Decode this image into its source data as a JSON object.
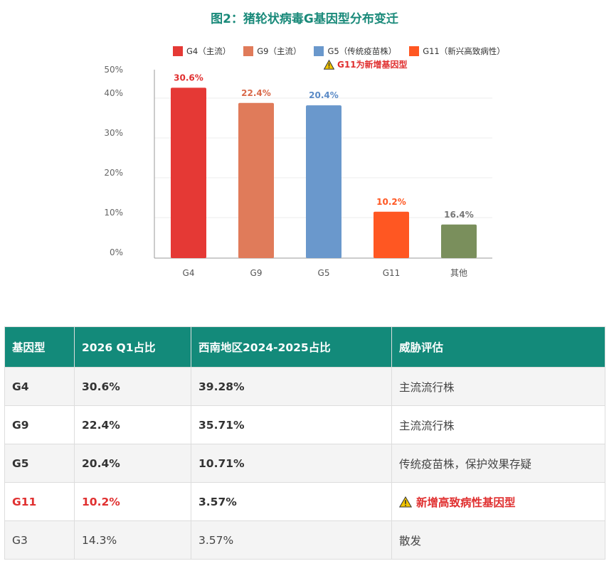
{
  "chart_data": {
    "type": "bar",
    "title": "图2：猪轮状病毒G基因型分布变迁",
    "categories": [
      "G4",
      "G9",
      "G5",
      "G11",
      "其他"
    ],
    "values": [
      30.6,
      22.4,
      20.4,
      10.2,
      16.4
    ],
    "bar_heights": [
      42.6,
      38.8,
      38.2,
      11.6,
      8.4
    ],
    "data_labels": [
      "30.6%",
      "22.4%",
      "20.4%",
      "10.2%",
      "16.4%"
    ],
    "colors": [
      "#e53935",
      "#e07b5a",
      "#6a98cc",
      "#ff5722",
      "#7a8f5c"
    ],
    "label_colors": [
      "#e03030",
      "#d9694a",
      "#5a8ac6",
      "#ff5722",
      "#777777"
    ],
    "ylim": [
      0,
      50
    ],
    "yticks": [
      "0%",
      "10%",
      "20%",
      "30%",
      "40%",
      "50%"
    ],
    "legend": [
      {
        "label": "G4（主流）",
        "color": "#e53935"
      },
      {
        "label": "G9（主流）",
        "color": "#e07b5a"
      },
      {
        "label": "G5（传统疫苗株）",
        "color": "#6a98cc"
      },
      {
        "label": "G11（新兴高致病性）",
        "color": "#ff5722"
      }
    ],
    "legend_position": "top",
    "annotation": "G11为新增基因型",
    "grid": true
  },
  "table": {
    "headers": [
      "基因型",
      "2026 Q1占比",
      "西南地区2024-2025占比",
      "威胁评估"
    ],
    "rows": [
      {
        "genotype": "G4",
        "q1": "30.6%",
        "sw": "39.28%",
        "assess": "主流流行株"
      },
      {
        "genotype": "G9",
        "q1": "22.4%",
        "sw": "35.71%",
        "assess": "主流流行株"
      },
      {
        "genotype": "G5",
        "q1": "20.4%",
        "sw": "10.71%",
        "assess": "传统疫苗株，保护效果存疑"
      },
      {
        "genotype": "G11",
        "q1": "10.2%",
        "sw": "3.57%",
        "assess": "新增高致病性基因型"
      },
      {
        "genotype": "G3",
        "q1": "14.3%",
        "sw": "3.57%",
        "assess": "散发"
      }
    ]
  }
}
